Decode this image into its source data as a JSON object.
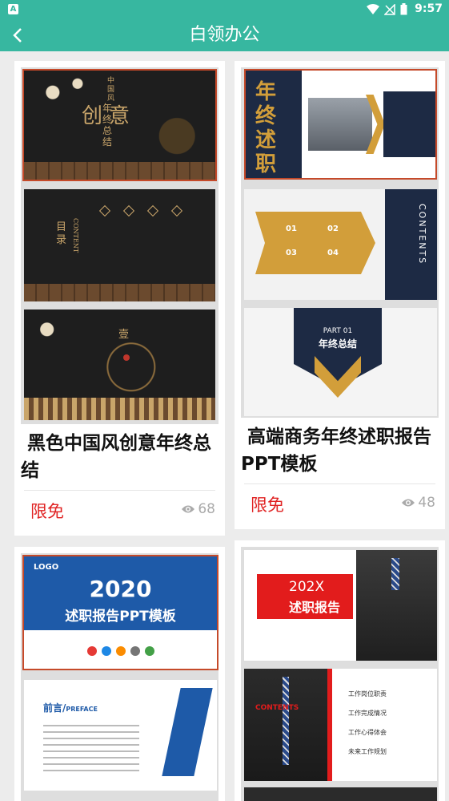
{
  "status_bar": {
    "time": "9:57",
    "app_badge": "A"
  },
  "app_bar": {
    "title": "白领办公"
  },
  "cards": [
    {
      "title": "黑色中国风创意年终总结",
      "price": "限免",
      "views": "68",
      "slide_texts": {
        "s1_big": "创意",
        "s1_sub": "中国风",
        "s1_vert": "年终总结",
        "s2_title": "目录",
        "s2_en": "CONTENT",
        "s3_char": "壹"
      }
    },
    {
      "title": "高端商务年终述职报告PPT模板",
      "price": "限免",
      "views": "48",
      "slide_texts": {
        "s1_big": "年终述职",
        "s2_side": "CONTENTS",
        "s2_items": [
          "01",
          "02",
          "03",
          "04"
        ],
        "s3_part": "PART 01",
        "s3_title": "年终总结"
      }
    },
    {
      "title": "",
      "price": "",
      "views": "",
      "slide_texts": {
        "logo": "LOGO",
        "year": "2020",
        "subtitle": "述职报告PPT模板",
        "s2_title": "前言/",
        "s2_en": "PREFACE"
      }
    },
    {
      "title": "",
      "price": "",
      "views": "",
      "slide_texts": {
        "s1_year": "202X",
        "s1_title": "述职报告",
        "s2_contents": "CONTENTS",
        "s2_items": [
          "工作岗位职责",
          "工作完成情况",
          "工作心得体会",
          "未来工作规划"
        ]
      }
    }
  ],
  "colors": {
    "accent": "#37b7a0",
    "price": "#e02323"
  }
}
